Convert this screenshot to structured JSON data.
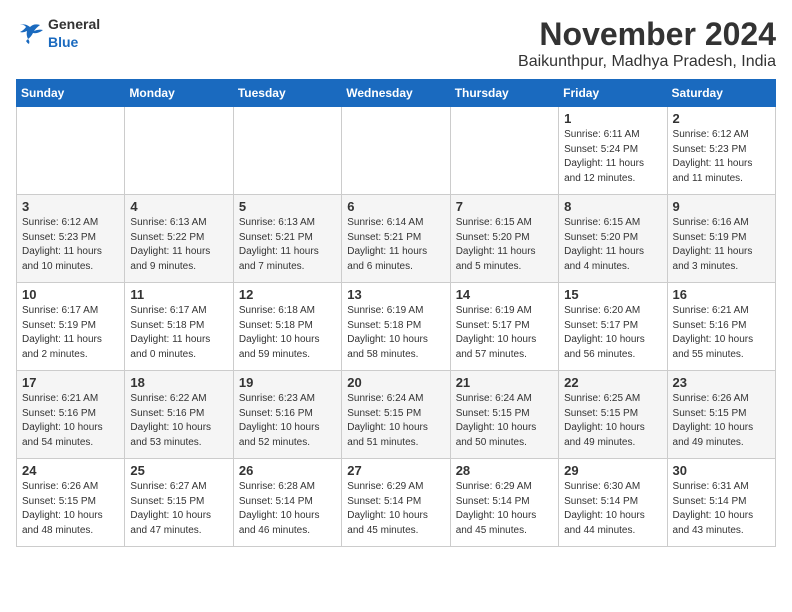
{
  "header": {
    "logo_general": "General",
    "logo_blue": "Blue",
    "month": "November 2024",
    "location": "Baikunthpur, Madhya Pradesh, India"
  },
  "weekdays": [
    "Sunday",
    "Monday",
    "Tuesday",
    "Wednesday",
    "Thursday",
    "Friday",
    "Saturday"
  ],
  "weeks": [
    [
      {
        "day": "",
        "info": ""
      },
      {
        "day": "",
        "info": ""
      },
      {
        "day": "",
        "info": ""
      },
      {
        "day": "",
        "info": ""
      },
      {
        "day": "",
        "info": ""
      },
      {
        "day": "1",
        "info": "Sunrise: 6:11 AM\nSunset: 5:24 PM\nDaylight: 11 hours\nand 12 minutes."
      },
      {
        "day": "2",
        "info": "Sunrise: 6:12 AM\nSunset: 5:23 PM\nDaylight: 11 hours\nand 11 minutes."
      }
    ],
    [
      {
        "day": "3",
        "info": "Sunrise: 6:12 AM\nSunset: 5:23 PM\nDaylight: 11 hours\nand 10 minutes."
      },
      {
        "day": "4",
        "info": "Sunrise: 6:13 AM\nSunset: 5:22 PM\nDaylight: 11 hours\nand 9 minutes."
      },
      {
        "day": "5",
        "info": "Sunrise: 6:13 AM\nSunset: 5:21 PM\nDaylight: 11 hours\nand 7 minutes."
      },
      {
        "day": "6",
        "info": "Sunrise: 6:14 AM\nSunset: 5:21 PM\nDaylight: 11 hours\nand 6 minutes."
      },
      {
        "day": "7",
        "info": "Sunrise: 6:15 AM\nSunset: 5:20 PM\nDaylight: 11 hours\nand 5 minutes."
      },
      {
        "day": "8",
        "info": "Sunrise: 6:15 AM\nSunset: 5:20 PM\nDaylight: 11 hours\nand 4 minutes."
      },
      {
        "day": "9",
        "info": "Sunrise: 6:16 AM\nSunset: 5:19 PM\nDaylight: 11 hours\nand 3 minutes."
      }
    ],
    [
      {
        "day": "10",
        "info": "Sunrise: 6:17 AM\nSunset: 5:19 PM\nDaylight: 11 hours\nand 2 minutes."
      },
      {
        "day": "11",
        "info": "Sunrise: 6:17 AM\nSunset: 5:18 PM\nDaylight: 11 hours\nand 0 minutes."
      },
      {
        "day": "12",
        "info": "Sunrise: 6:18 AM\nSunset: 5:18 PM\nDaylight: 10 hours\nand 59 minutes."
      },
      {
        "day": "13",
        "info": "Sunrise: 6:19 AM\nSunset: 5:18 PM\nDaylight: 10 hours\nand 58 minutes."
      },
      {
        "day": "14",
        "info": "Sunrise: 6:19 AM\nSunset: 5:17 PM\nDaylight: 10 hours\nand 57 minutes."
      },
      {
        "day": "15",
        "info": "Sunrise: 6:20 AM\nSunset: 5:17 PM\nDaylight: 10 hours\nand 56 minutes."
      },
      {
        "day": "16",
        "info": "Sunrise: 6:21 AM\nSunset: 5:16 PM\nDaylight: 10 hours\nand 55 minutes."
      }
    ],
    [
      {
        "day": "17",
        "info": "Sunrise: 6:21 AM\nSunset: 5:16 PM\nDaylight: 10 hours\nand 54 minutes."
      },
      {
        "day": "18",
        "info": "Sunrise: 6:22 AM\nSunset: 5:16 PM\nDaylight: 10 hours\nand 53 minutes."
      },
      {
        "day": "19",
        "info": "Sunrise: 6:23 AM\nSunset: 5:16 PM\nDaylight: 10 hours\nand 52 minutes."
      },
      {
        "day": "20",
        "info": "Sunrise: 6:24 AM\nSunset: 5:15 PM\nDaylight: 10 hours\nand 51 minutes."
      },
      {
        "day": "21",
        "info": "Sunrise: 6:24 AM\nSunset: 5:15 PM\nDaylight: 10 hours\nand 50 minutes."
      },
      {
        "day": "22",
        "info": "Sunrise: 6:25 AM\nSunset: 5:15 PM\nDaylight: 10 hours\nand 49 minutes."
      },
      {
        "day": "23",
        "info": "Sunrise: 6:26 AM\nSunset: 5:15 PM\nDaylight: 10 hours\nand 49 minutes."
      }
    ],
    [
      {
        "day": "24",
        "info": "Sunrise: 6:26 AM\nSunset: 5:15 PM\nDaylight: 10 hours\nand 48 minutes."
      },
      {
        "day": "25",
        "info": "Sunrise: 6:27 AM\nSunset: 5:15 PM\nDaylight: 10 hours\nand 47 minutes."
      },
      {
        "day": "26",
        "info": "Sunrise: 6:28 AM\nSunset: 5:14 PM\nDaylight: 10 hours\nand 46 minutes."
      },
      {
        "day": "27",
        "info": "Sunrise: 6:29 AM\nSunset: 5:14 PM\nDaylight: 10 hours\nand 45 minutes."
      },
      {
        "day": "28",
        "info": "Sunrise: 6:29 AM\nSunset: 5:14 PM\nDaylight: 10 hours\nand 45 minutes."
      },
      {
        "day": "29",
        "info": "Sunrise: 6:30 AM\nSunset: 5:14 PM\nDaylight: 10 hours\nand 44 minutes."
      },
      {
        "day": "30",
        "info": "Sunrise: 6:31 AM\nSunset: 5:14 PM\nDaylight: 10 hours\nand 43 minutes."
      }
    ]
  ]
}
